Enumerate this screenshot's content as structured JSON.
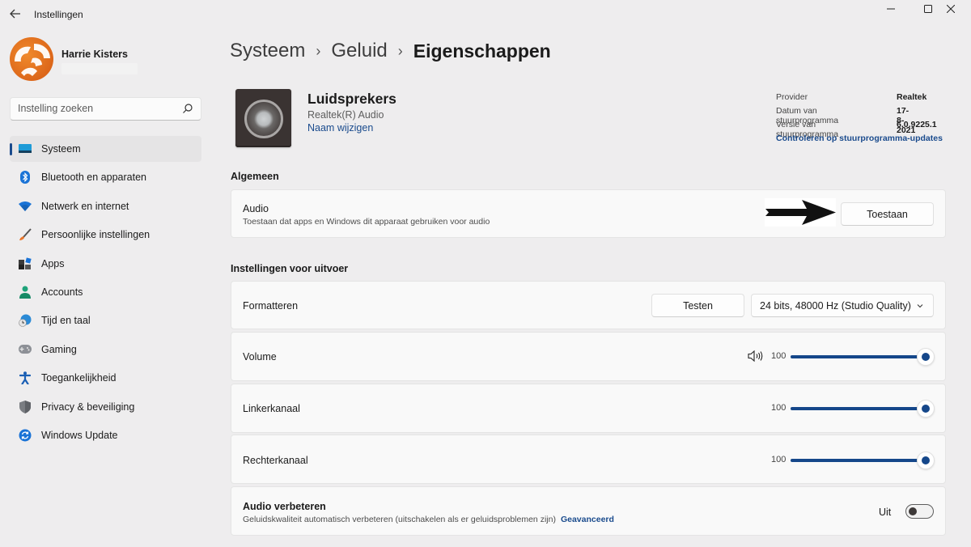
{
  "window": {
    "title": "Instellingen",
    "controls": {
      "minimize": "—",
      "maximize": "☐",
      "close": "✕"
    }
  },
  "profile": {
    "name": "Harrie Kisters"
  },
  "search": {
    "placeholder": "Instelling zoeken"
  },
  "sidebar": {
    "items": [
      {
        "label": "Systeem",
        "icon": "system-icon",
        "active": true
      },
      {
        "label": "Bluetooth en apparaten",
        "icon": "bluetooth-icon"
      },
      {
        "label": "Netwerk en internet",
        "icon": "wifi-icon"
      },
      {
        "label": "Persoonlijke instellingen",
        "icon": "brush-icon"
      },
      {
        "label": "Apps",
        "icon": "apps-icon"
      },
      {
        "label": "Accounts",
        "icon": "person-icon"
      },
      {
        "label": "Tijd en taal",
        "icon": "globe-clock-icon"
      },
      {
        "label": "Gaming",
        "icon": "gamepad-icon"
      },
      {
        "label": "Toegankelijkheid",
        "icon": "accessibility-icon"
      },
      {
        "label": "Privacy & beveiliging",
        "icon": "shield-icon"
      },
      {
        "label": "Windows Update",
        "icon": "update-icon"
      }
    ]
  },
  "breadcrumb": {
    "items": [
      "Systeem",
      "Geluid"
    ],
    "separator": "›",
    "current": "Eigenschappen"
  },
  "device": {
    "name": "Luidsprekers",
    "driver": "Realtek(R) Audio",
    "rename_link": "Naam wijzigen"
  },
  "driver_info": {
    "rows": [
      {
        "label": "Provider",
        "value": "Realtek"
      },
      {
        "label": "Datum van stuurprogramma",
        "value": "17-8-2021"
      },
      {
        "label": "Versie van stuurprogramma",
        "value": "6.0.9225.1"
      }
    ],
    "update_link": "Controleren op stuurprogramma-updates"
  },
  "general": {
    "section_title": "Algemeen",
    "audio": {
      "title": "Audio",
      "description": "Toestaan dat apps en Windows dit apparaat gebruiken voor audio",
      "button": "Toestaan"
    }
  },
  "output": {
    "section_title": "Instellingen voor uitvoer",
    "format": {
      "title": "Formatteren",
      "test_button": "Testen",
      "selected": "24 bits, 48000 Hz (Studio Quality)"
    },
    "volume": {
      "title": "Volume",
      "value": "100",
      "percent": 100
    },
    "left": {
      "title": "Linkerkanaal",
      "value": "100",
      "percent": 100
    },
    "right": {
      "title": "Rechterkanaal",
      "value": "100",
      "percent": 100
    },
    "enhance": {
      "title": "Audio verbeteren",
      "description": "Geluidskwaliteit automatisch verbeteren (uitschakelen als er geluidsproblemen zijn)",
      "advanced_link": "Geavanceerd",
      "toggle_label": "Uit",
      "toggle_on": false
    }
  },
  "colors": {
    "accent": "#15478a",
    "link": "#1a4b8d",
    "background": "#eeedee",
    "card": "#f9f9f9"
  }
}
